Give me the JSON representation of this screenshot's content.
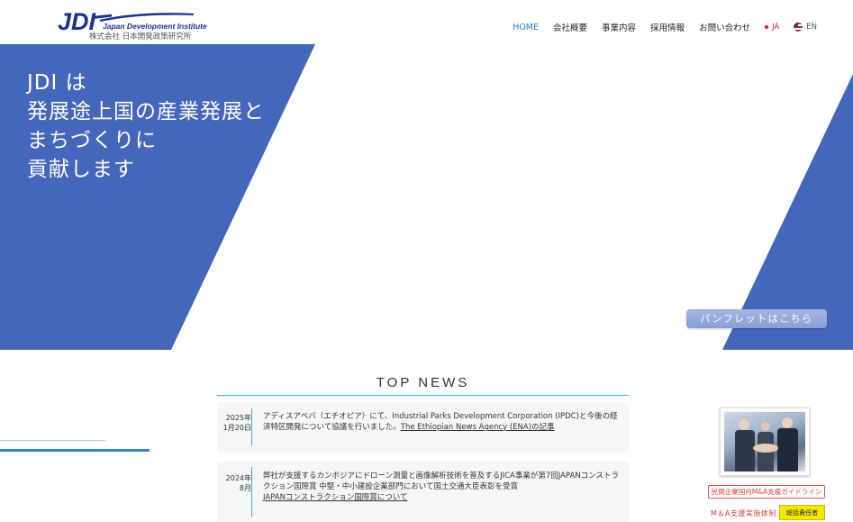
{
  "header": {
    "logo_text": "JDI",
    "logo_en": "Japan Development Institute",
    "logo_ja": "株式会社 日本開発政策研究所",
    "nav": [
      {
        "label": "HOME",
        "active": true
      },
      {
        "label": "会社概要",
        "active": false
      },
      {
        "label": "事業内容",
        "active": false
      },
      {
        "label": "採用情報",
        "active": false
      },
      {
        "label": "お問い合わせ",
        "active": false
      }
    ],
    "lang_ja": "JA",
    "lang_en": "EN"
  },
  "hero": {
    "title_lines": [
      "JDI は",
      "発展途上国の産業発展と",
      "まちづくりに",
      "貢献します"
    ],
    "pamphlet_label": "パンフレットはこちら",
    "colors": {
      "panel": "#4466bb"
    }
  },
  "news": {
    "heading": "TOP NEWS",
    "items": [
      {
        "date_year": "2025年",
        "date_day": "1月20日",
        "text": "アディスアベバ（エチオピア）にて、Industrial Parks Development Corporation (IPDC)と今後の経済特区開発について協議を行いました。",
        "link": "The Ethiopian News Agency (ENA)の記事"
      },
      {
        "date_year": "2024年",
        "date_day": "8月",
        "text": "弊社が支援するカンボジアにドローン測量と画像解析技術を普及するJICA事業が第7回JAPANコンストラクション国際賞 中堅・中小建設企業部門において国土交通大臣表彰を受賞",
        "link": "JAPANコンストラクション国際賞について"
      }
    ]
  },
  "sidebar": {
    "badge_link": "民間企業国内M&A支援ガイドライン",
    "ma_label": "M＆A支援実施体制",
    "resp_tag": "総括責任者"
  }
}
